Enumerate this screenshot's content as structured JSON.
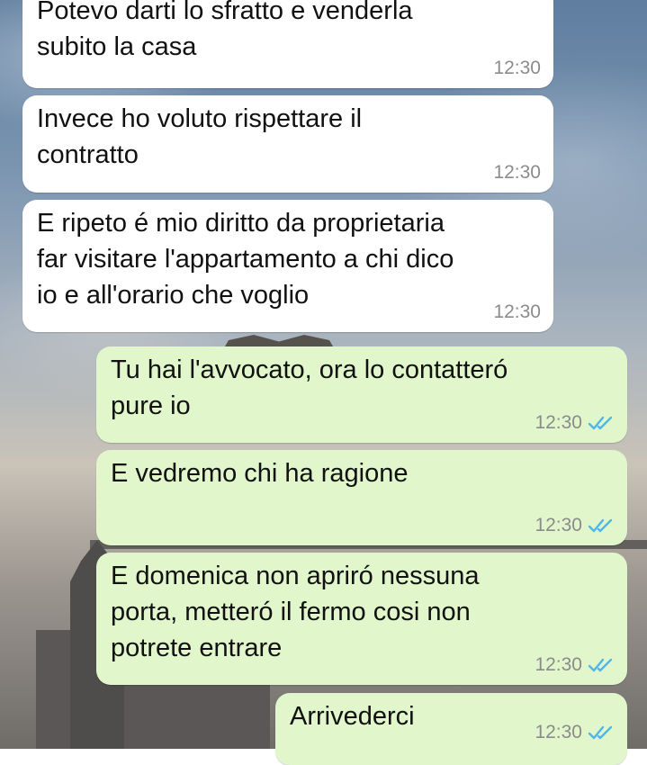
{
  "chat": {
    "messages": [
      {
        "direction": "incoming",
        "text": "Potevo darti lo sfratto e venderla\nsubito la casa",
        "time": "12:30"
      },
      {
        "direction": "incoming",
        "text": "Invece ho voluto rispettare il\ncontratto",
        "time": "12:30"
      },
      {
        "direction": "incoming",
        "text": "E ripeto é mio diritto da proprietaria\nfar visitare l'appartamento a chi dico\nio e all'orario che voglio",
        "time": "12:30"
      },
      {
        "direction": "outgoing",
        "text": "Tu hai l'avvocato, ora lo contatteró\npure io",
        "time": "12:30",
        "status": "read"
      },
      {
        "direction": "outgoing",
        "text": "E vedremo chi ha ragione",
        "time": "12:30",
        "status": "read"
      },
      {
        "direction": "outgoing",
        "text": "E domenica non apriró nessuna\nporta, metteró il fermo cosi non\npotrete entrare",
        "time": "12:30",
        "status": "read"
      },
      {
        "direction": "outgoing",
        "text": "Arrivederci",
        "time": "12:30",
        "status": "read"
      }
    ]
  },
  "colors": {
    "incoming_bubble": "#ffffff",
    "outgoing_bubble": "#e1f7cb",
    "read_ticks": "#4fb6ec",
    "timestamp": "#8b8b8b"
  },
  "icons": {
    "read_receipt": "double-check-icon"
  }
}
